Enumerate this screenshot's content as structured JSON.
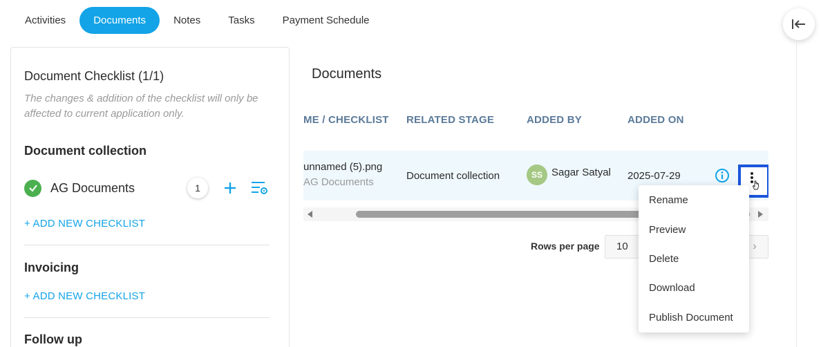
{
  "tabs": [
    {
      "label": "Activities"
    },
    {
      "label": "Documents",
      "active": true
    },
    {
      "label": "Notes"
    },
    {
      "label": "Tasks"
    },
    {
      "label": "Payment Schedule"
    }
  ],
  "checklist": {
    "title": "Document Checklist (1/1)",
    "note": "The changes & addition of the checklist will only be affected to current application only.",
    "sections": [
      {
        "title": "Document collection",
        "items": [
          {
            "label": "AG Documents",
            "count": "1",
            "done": true
          }
        ],
        "add_label": "+ ADD NEW CHECKLIST"
      },
      {
        "title": "Invoicing",
        "add_label": "+ ADD NEW CHECKLIST"
      },
      {
        "title": "Follow up"
      }
    ]
  },
  "documents": {
    "title": "Documents",
    "columns": [
      "ME / CHECKLIST",
      "RELATED STAGE",
      "ADDED BY",
      "ADDED ON"
    ],
    "rows": [
      {
        "name": "unnamed (5).png",
        "checklist": "AG Documents",
        "stage": "Document collection",
        "added_by_initials": "SS",
        "added_by": "Sagar Satyal",
        "added_on": "2025-07-29"
      }
    ],
    "rows_per_page_label": "Rows per page",
    "rows_per_page": "10",
    "next_page_glyph": "›"
  },
  "menu": {
    "items": [
      "Rename",
      "Preview",
      "Delete",
      "Download",
      "Publish Document"
    ]
  },
  "colors": {
    "accent": "#13a4e8",
    "success": "#4caf50",
    "highlight_border": "#1a56db"
  }
}
